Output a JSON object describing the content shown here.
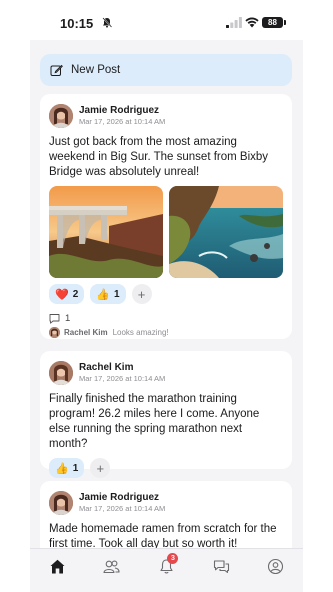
{
  "status_bar": {
    "time": "10:15",
    "battery": "88"
  },
  "composer": {
    "label": "New Post"
  },
  "posts": [
    {
      "author": "Jamie Rodriguez",
      "date": "Mar 17, 2026 at 10:14 AM",
      "text": "Just got back from the most amazing weekend in Big Sur. The sunset from Bixby Bridge was absolutely unreal!",
      "reactions": [
        {
          "emoji": "❤️",
          "count": "2"
        },
        {
          "emoji": "👍",
          "count": "1"
        }
      ],
      "comment_count": "1",
      "comment_preview": {
        "author": "Rachel Kim",
        "text": "Looks amazing!"
      }
    },
    {
      "author": "Rachel Kim",
      "date": "Mar 17, 2026 at 10:14 AM",
      "text": "Finally finished the marathon training program! 26.2 miles here I come. Anyone else running the spring marathon next month?",
      "reactions": [
        {
          "emoji": "👍",
          "count": "1"
        }
      ]
    },
    {
      "author": "Jamie Rodriguez",
      "date": "Mar 17, 2026 at 10:14 AM",
      "text": "Made homemade ramen from scratch for the first time. Took all day but so worth it!"
    }
  ],
  "tabbar": {
    "notifications_badge": "3"
  },
  "colors": {
    "accent_light": "#dcecfb",
    "badge": "#e5484d",
    "background": "#f4f4f6"
  },
  "icons": [
    "bell-off-icon",
    "signal-icon",
    "wifi-icon",
    "battery-icon",
    "edit-icon",
    "comment-icon",
    "home-icon",
    "friends-icon",
    "bell-icon",
    "messages-icon",
    "profile-icon",
    "plus-icon"
  ]
}
